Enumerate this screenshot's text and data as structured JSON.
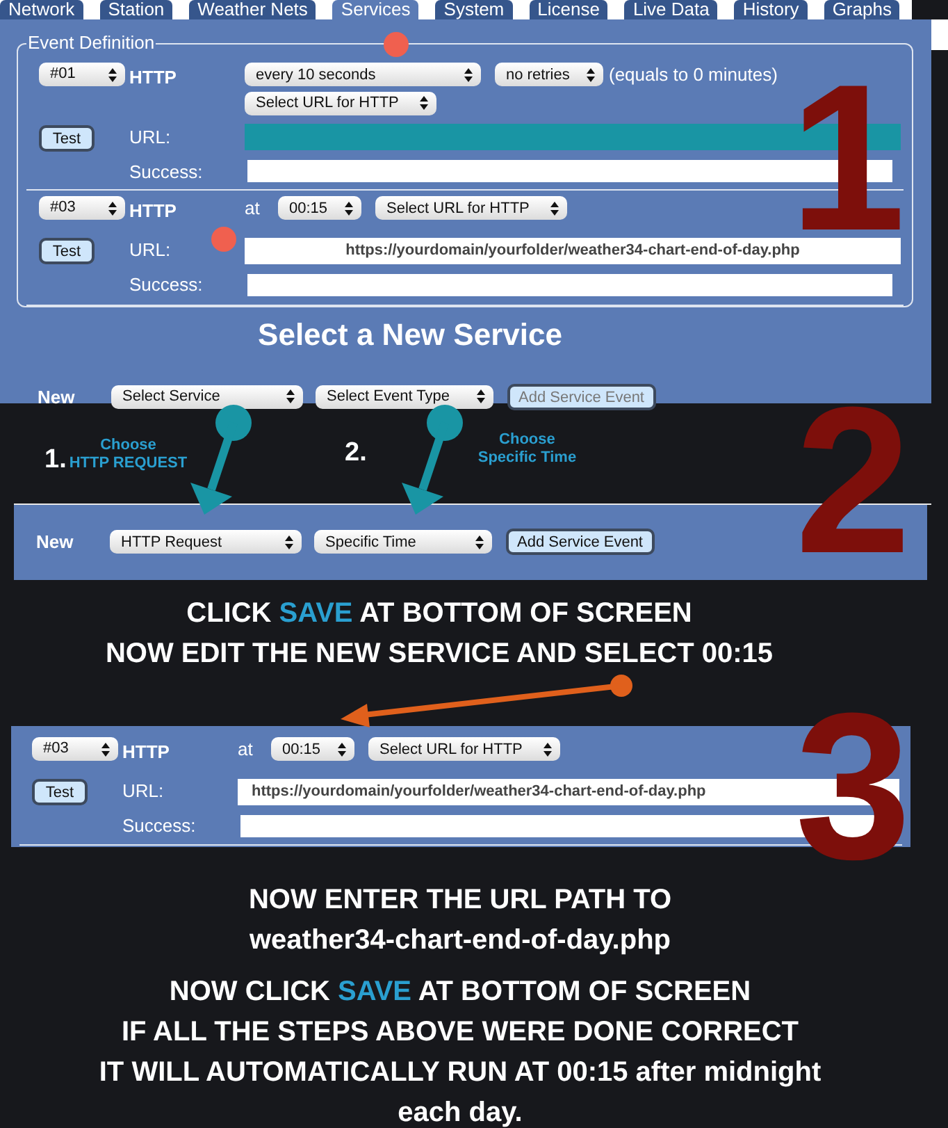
{
  "tabs": [
    {
      "label": "Network",
      "selected": false
    },
    {
      "label": "Station",
      "selected": false
    },
    {
      "label": "Weather Nets",
      "selected": false
    },
    {
      "label": "Services",
      "selected": true
    },
    {
      "label": "System",
      "selected": false
    },
    {
      "label": "License",
      "selected": false
    },
    {
      "label": "Live Data",
      "selected": false
    },
    {
      "label": "History",
      "selected": false
    },
    {
      "label": "Graphs",
      "selected": false
    }
  ],
  "event_definition": {
    "legend": "Event Definition",
    "events": [
      {
        "kind": "interval",
        "number": "#01",
        "service": "HTTP",
        "interval": "every 10 seconds",
        "retries": "no retries",
        "note": "(equals to 0 minutes)",
        "url_select": "Select URL for HTTP",
        "test": "Test",
        "url_label": "URL:",
        "url_highlighted": true,
        "success_label": "Success:"
      },
      {
        "kind": "time",
        "number": "#03",
        "service": "HTTP",
        "at_label": "at",
        "time": "00:15",
        "url_select": "Select URL for HTTP",
        "test": "Test",
        "url_label": "URL:",
        "url": "https://yourdomain/yourfolder/weather34-chart-end-of-day.php",
        "url_highlighted": false,
        "success_label": "Success:"
      }
    ]
  },
  "new_service": {
    "heading": "Select a New Service",
    "label": "New",
    "service": "Select Service",
    "event_type": "Select Event Type",
    "button": "Add Service Event",
    "button_disabled": true
  },
  "steps": [
    {
      "number": "1.",
      "lines": [
        "Choose",
        "HTTP REQUEST"
      ]
    },
    {
      "number": "2.",
      "lines": [
        "Choose",
        "Specific Time"
      ]
    }
  ],
  "new_service_filled": {
    "label": "New",
    "service": "HTTP Request",
    "event_type": "Specific Time",
    "button": "Add Service Event",
    "button_disabled": false
  },
  "instructions_1": [
    "CLICK **SAVE** AT BOTTOM OF SCREEN",
    "NOW EDIT THE NEW SERVICE  AND SELECT 00:15"
  ],
  "edited_event": {
    "kind": "time",
    "number": "#03",
    "service": "HTTP",
    "at_label": "at",
    "time": "00:15",
    "url_select": "Select URL for HTTP",
    "test": "Test",
    "url_label": "URL:",
    "url": "https://yourdomain/yourfolder/weather34-chart-end-of-day.php",
    "url_highlighted": false,
    "success_label": "Success:"
  },
  "instructions_2": [
    "NOW ENTER THE URL PATH TO",
    "weather34-chart-end-of-day.php"
  ],
  "instructions_3": [
    "NOW CLICK **SAVE** AT BOTTOM OF SCREEN",
    "IF ALL THE STEPS ABOVE WERE DONE CORRECT",
    "IT WILL AUTOMATICALLY RUN AT 00:15 after midnight",
    "each day."
  ],
  "step_numbers": [
    "1",
    "2",
    "3"
  ]
}
